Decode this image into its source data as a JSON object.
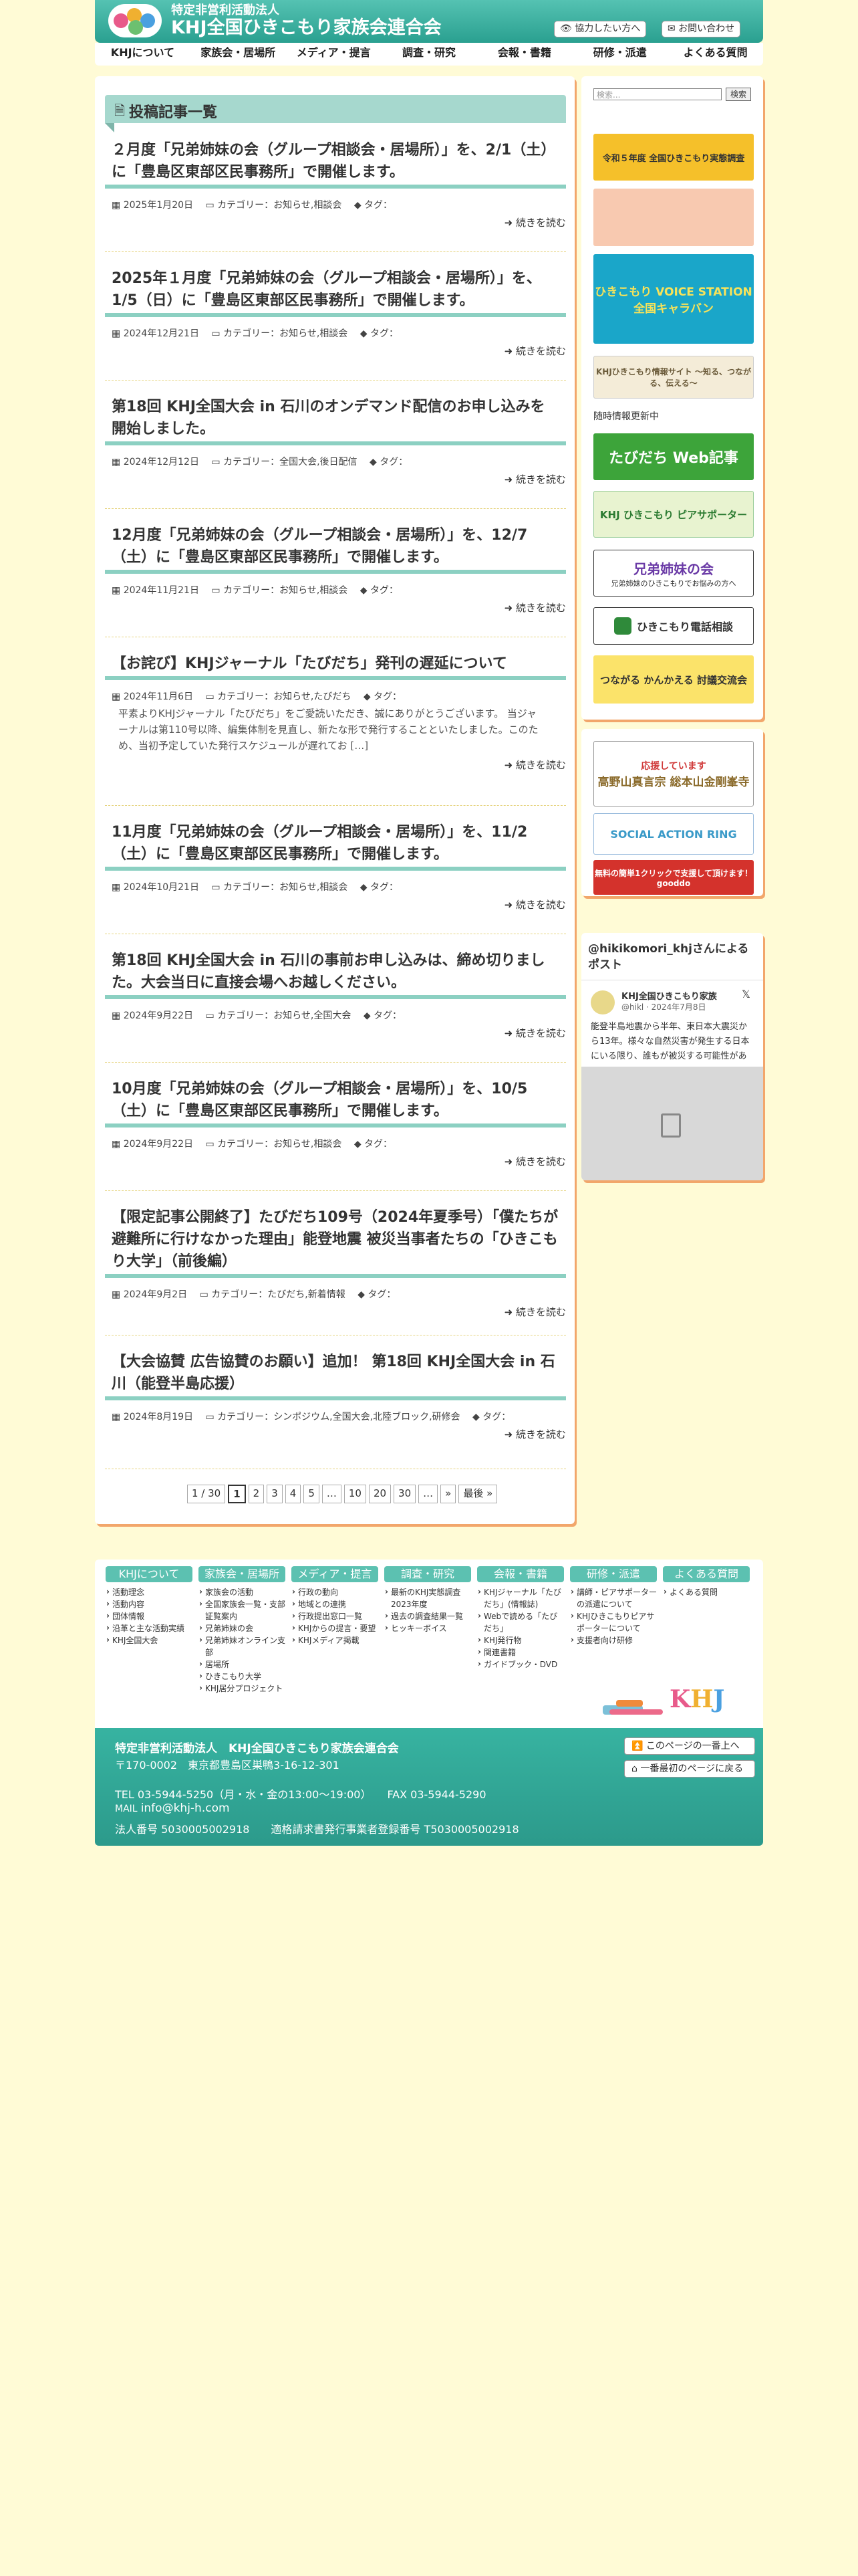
{
  "header": {
    "org_line": "特定非営利活動法人",
    "name_line": "KHJ全国ひきこもり家族会連合会",
    "cooperate_button": "協力したい方へ",
    "contact_button": "お問い合わせ"
  },
  "nav": [
    "KHJについて",
    "家族会・居場所",
    "メディア・提言",
    "調査・研究",
    "会報・書籍",
    "研修・派遣",
    "よくある質問"
  ],
  "list_title": "投稿記事一覧",
  "labels": {
    "category": "カテゴリー：",
    "tag": "タグ：",
    "more": "続きを読む"
  },
  "posts": [
    {
      "title": "２月度「兄弟姉妹の会（グループ相談会・居場所）」を、2/1（土）に「豊島区東部区民事務所」で開催します。",
      "date": "2025年1月20日",
      "categories": "お知らせ,相談会"
    },
    {
      "title": "2025年１月度「兄弟姉妹の会（グループ相談会・居場所）」を、1/5（日）に「豊島区東部区民事務所」で開催します。",
      "date": "2024年12月21日",
      "categories": "お知らせ,相談会"
    },
    {
      "title": "第18回 KHJ全国大会 in 石川のオンデマンド配信のお申し込みを開始しました。",
      "date": "2024年12月12日",
      "categories": "全国大会,後日配信"
    },
    {
      "title": "12月度「兄弟姉妹の会（グループ相談会・居場所）」を、12/7（土）に「豊島区東部区民事務所」で開催します。",
      "date": "2024年11月21日",
      "categories": "お知らせ,相談会"
    },
    {
      "title": "【お詫び】KHJジャーナル「たびだち」発刊の遅延について",
      "date": "2024年11月6日",
      "categories": "お知らせ,たびだち",
      "excerpt": "平素よりKHJジャーナル「たびだち」をご愛読いただき、誠にありがとうございます。 当ジャーナルは第110号以降、編集体制を見直し、新たな形で発行することといたしました。このため、当初予定していた発行スケジュールが遅れてお […]"
    },
    {
      "title": "11月度「兄弟姉妹の会（グループ相談会・居場所）」を、11/2（土）に「豊島区東部区民事務所」で開催します。",
      "date": "2024年10月21日",
      "categories": "お知らせ,相談会"
    },
    {
      "title": "第18回 KHJ全国大会 in 石川の事前お申し込みは、締め切りました。大会当日に直接会場へお越しください。",
      "date": "2024年9月22日",
      "categories": "お知らせ,全国大会"
    },
    {
      "title": "10月度「兄弟姉妹の会（グループ相談会・居場所）」を、10/5（土）に「豊島区東部区民事務所」で開催します。",
      "date": "2024年9月22日",
      "categories": "お知らせ,相談会"
    },
    {
      "title": "【限定記事公開終了】たびだち109号（2024年夏季号）「僕たちが避難所に行けなかった理由」能登地震 被災当事者たちの「ひきこもり大学」（前後編）",
      "date": "2024年9月2日",
      "categories": "たびだち,新着情報"
    },
    {
      "title": "【大会協賛 広告協賛のお願い】追加！ 第18回 KHJ全国大会 in 石川（能登半島応援）",
      "date": "2024年8月19日",
      "categories": "シンポジウム,全国大会,北陸ブロック,研修会"
    }
  ],
  "pager": [
    "1 / 30",
    "1",
    "2",
    "3",
    "4",
    "5",
    "…",
    "10",
    "20",
    "30",
    "…",
    "»",
    "最後 »"
  ],
  "sidebar": {
    "search_button": "検索",
    "search_placeholder": "検索...",
    "update_label": "随時情報更新中",
    "banners": {
      "survey": "令和５年度 全国ひきこもり実態調査",
      "voice": "ひきこもり VOICE STATION 全国キャラバン",
      "hiroba": "KHJひきこもり情報サイト ～知る、つながる、伝える～",
      "tabidachi": "たびだち Web記事",
      "peer": "KHJ ひきこもり ピアサポーター",
      "sibling": "兄弟姉妹の会",
      "sibling_sub": "兄弟姉妹のひきこもりでお悩みの方へ",
      "phone": "ひきこもり電話相談",
      "tsunagaru": "つながる かんかえる 討議交流会",
      "koyasan_top": "応援しています",
      "koyasan": "高野山真言宗 総本山金剛峯寺",
      "sar": "SOCIAL ACTION RING",
      "gooddo": "無料の簡単1クリックで支援して頂けます！ gooddo"
    },
    "twitter_title": "@hikikomori_khjさんによるポスト",
    "tweet_name": "KHJ全国ひきこもり家族",
    "tweet_handle": "@hikl · 2024年7月8日",
    "tweet_text": "能登半島地震から半年、東日本大震災から13年。様々な自然災害が発生する日本にいる限り、誰もが被災する可能性がある中で"
  },
  "footer": {
    "columns": [
      {
        "title": "KHJについて",
        "links": [
          "活動理念",
          "活動内容",
          "団体情報",
          "沿革と主な活動実績",
          "KHJ全国大会"
        ]
      },
      {
        "title": "家族会・居場所",
        "links": [
          "家族会の活動",
          "全国家族会一覧・支部証覧案内",
          "兄弟姉妹の会",
          "兄弟姉妹オンライン支部",
          "居場所",
          "ひきこもり大学",
          "KHJ居分プロジェクト"
        ]
      },
      {
        "title": "メディア・提言",
        "links": [
          "行政の動向",
          "地域との連携",
          "行政提出窓口一覧",
          "KHJからの提言・要望",
          "KHJメディア掲載"
        ]
      },
      {
        "title": "調査・研究",
        "links": [
          "最新のKHJ実態調査2023年度",
          "過去の調査結果一覧",
          "ヒッキーボイス"
        ]
      },
      {
        "title": "会報・書籍",
        "links": [
          "KHJジャーナル「たびだち」(情報誌)",
          "Webで読める「たびだち」",
          "KHJ発行物",
          "関連書籍",
          "ガイドブック・DVD"
        ]
      },
      {
        "title": "研修・派遣",
        "links": [
          "講師・ピアサポーターの派遣について",
          "KHJひきこもりピアサポーターについて",
          "支援者向け研修"
        ]
      },
      {
        "title": "よくある質問",
        "links": [
          "よくある質問"
        ]
      }
    ],
    "org": "特定非営利活動法人　KHJ全国ひきこもり家族会連合会",
    "address": "〒170-0002　東京都豊島区巣鴨3-16-12-301",
    "tel": "TEL 03-5944-5250（月・水・金の13:00～19:00）　　FAX 03-5944-5290",
    "mail_label": "MAIL",
    "mail": "info@khj-h.com",
    "corp_no": "法人番号 5030005002918　　適格請求書発行事業者登録番号 T5030005002918",
    "top_button": "このページの一番上へ",
    "home_button": "一番最初のページに戻る"
  },
  "colors": {
    "accent": "#2aa090",
    "underline": "#8cd0c2",
    "shadow": "#f2a66b",
    "background": "#fffbd6"
  }
}
